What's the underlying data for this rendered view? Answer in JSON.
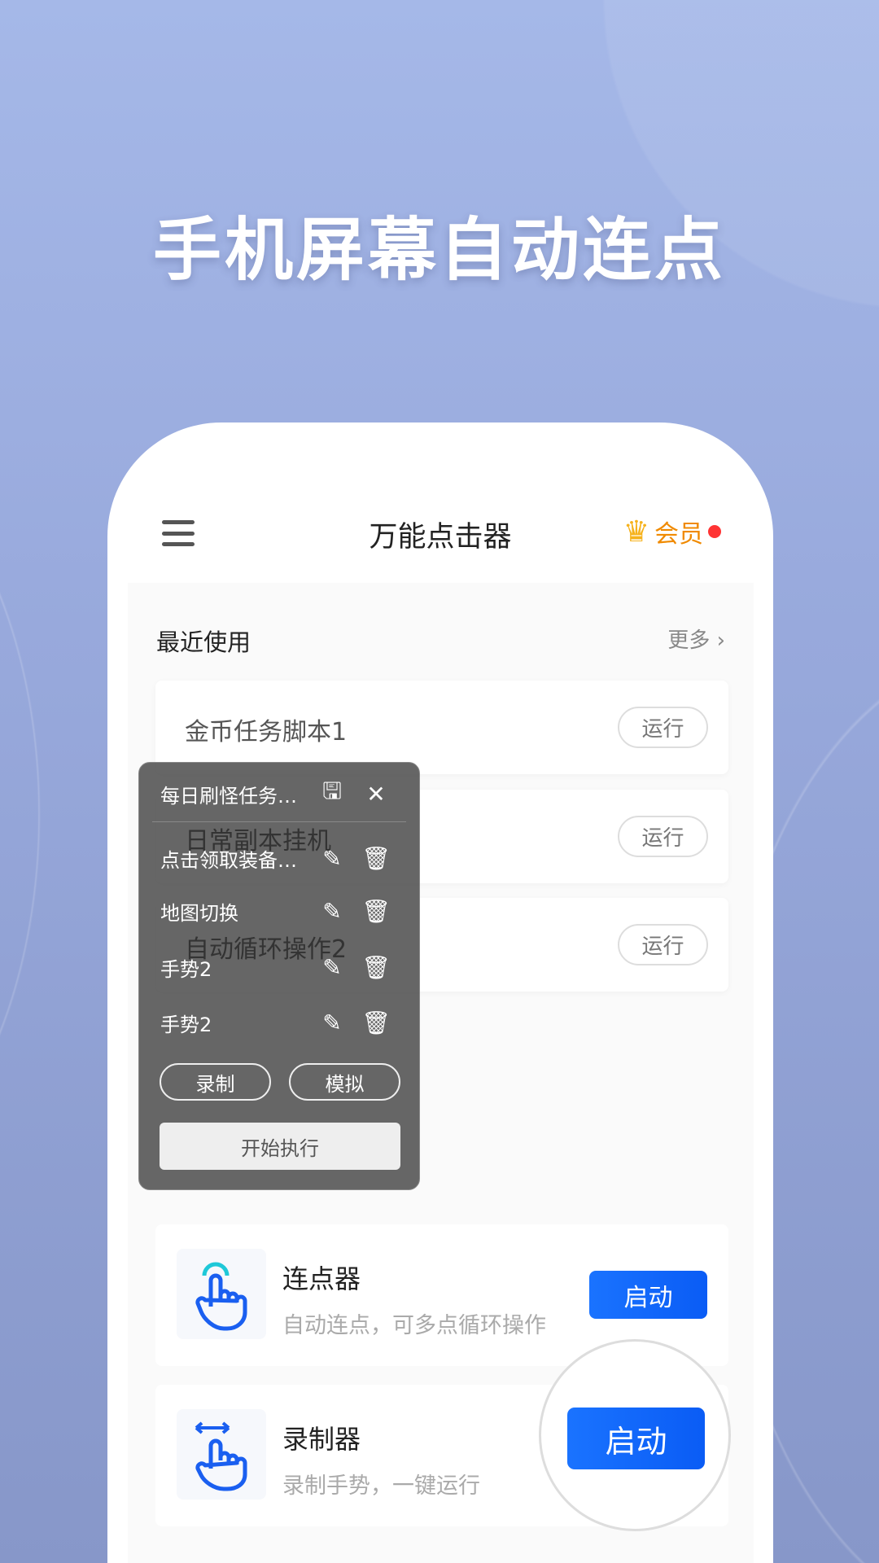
{
  "headline": "手机屏幕自动连点",
  "header": {
    "title": "万能点击器",
    "vip_label": "会员",
    "menu_icon": "hamburger-icon",
    "vip_icon": "crown-icon"
  },
  "recent": {
    "title": "最近使用",
    "more": "更多",
    "items": [
      {
        "name": "金币任务脚本1",
        "action": "运行"
      },
      {
        "name": "日常副本挂机",
        "action": "运行"
      },
      {
        "name": "自动循环操作2",
        "action": "运行"
      }
    ]
  },
  "panel": {
    "title": "每日刷怪任务…",
    "rows": [
      {
        "label": "点击领取装备…"
      },
      {
        "label": "地图切换"
      },
      {
        "label": "手势2"
      },
      {
        "label": "手势2"
      }
    ],
    "record": "录制",
    "simulate": "模拟",
    "start": "开始执行"
  },
  "tools": [
    {
      "title": "连点器",
      "subtitle": "自动连点，可多点循环操作",
      "action": "启动"
    },
    {
      "title": "录制器",
      "subtitle": "录制手势，一键运行",
      "action": "启动"
    }
  ],
  "colors": {
    "accent": "#1a73ff",
    "vip": "#f08a00"
  }
}
